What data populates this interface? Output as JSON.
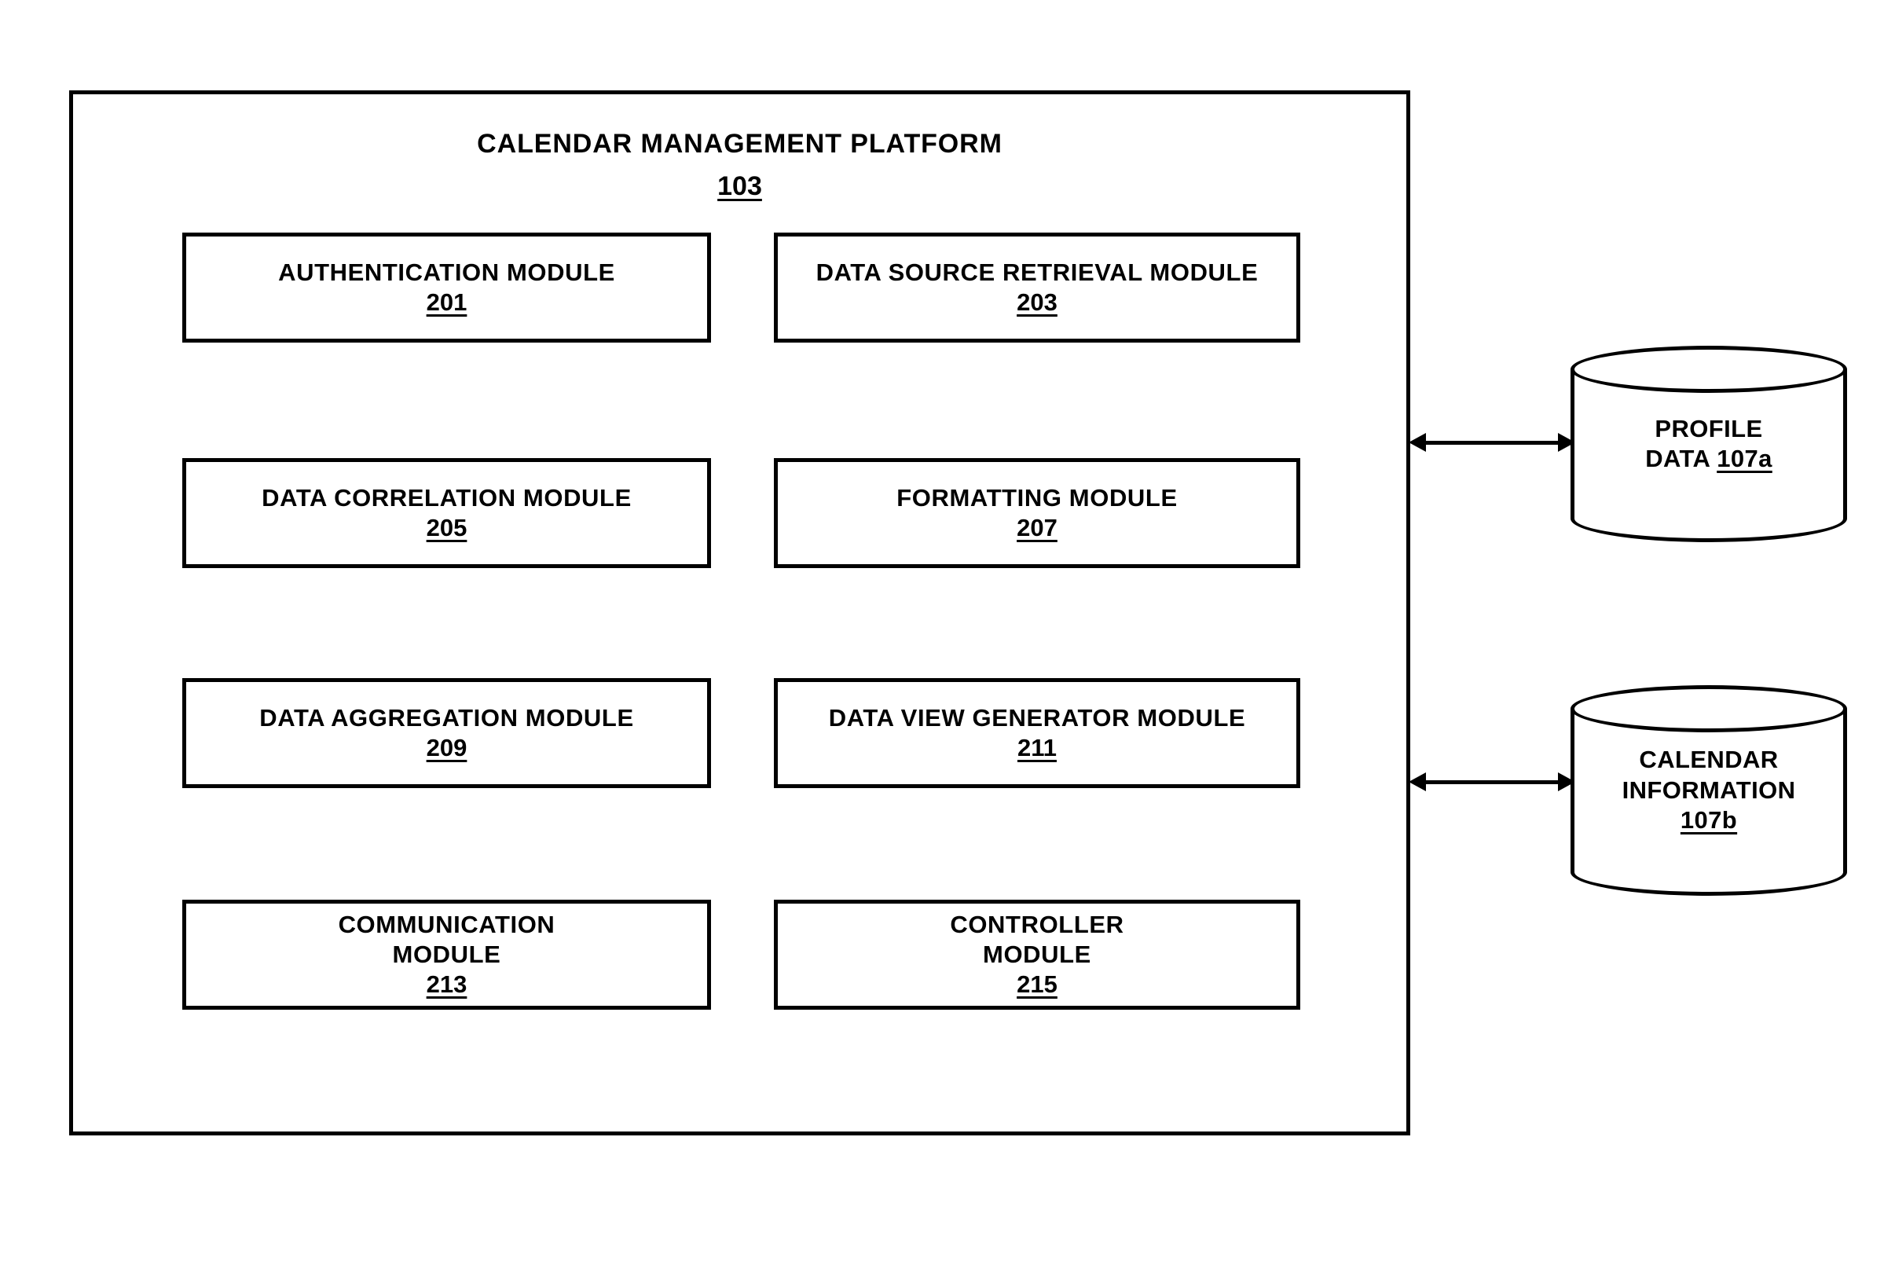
{
  "figure": {
    "platform": {
      "title": "CALENDAR MANAGEMENT PLATFORM",
      "reference": "103"
    },
    "modules": [
      {
        "label": "AUTHENTICATION MODULE",
        "reference": "201"
      },
      {
        "label": "DATA SOURCE RETRIEVAL MODULE",
        "reference": "203"
      },
      {
        "label": "DATA CORRELATION MODULE",
        "reference": "205"
      },
      {
        "label": "FORMATTING MODULE",
        "reference": "207"
      },
      {
        "label": "DATA AGGREGATION MODULE",
        "reference": "209"
      },
      {
        "label": "DATA VIEW GENERATOR MODULE",
        "reference": "211"
      },
      {
        "label": "COMMUNICATION\nMODULE",
        "reference": "213"
      },
      {
        "label": "CONTROLLER\nMODULE",
        "reference": "215"
      }
    ],
    "datastores": [
      {
        "name": "profile-data",
        "line1": "PROFILE",
        "line2": "DATA ",
        "reference": "107a"
      },
      {
        "name": "calendar-information",
        "line1": "CALENDAR",
        "line2": "INFORMATION",
        "reference": "107b"
      }
    ],
    "connectors": [
      {
        "name": "platform-to-profile-data",
        "style": "double-headed-arrow"
      },
      {
        "name": "platform-to-calendar-information",
        "style": "double-headed-arrow"
      }
    ],
    "colors": {
      "stroke": "#000000",
      "background": "#ffffff"
    }
  }
}
